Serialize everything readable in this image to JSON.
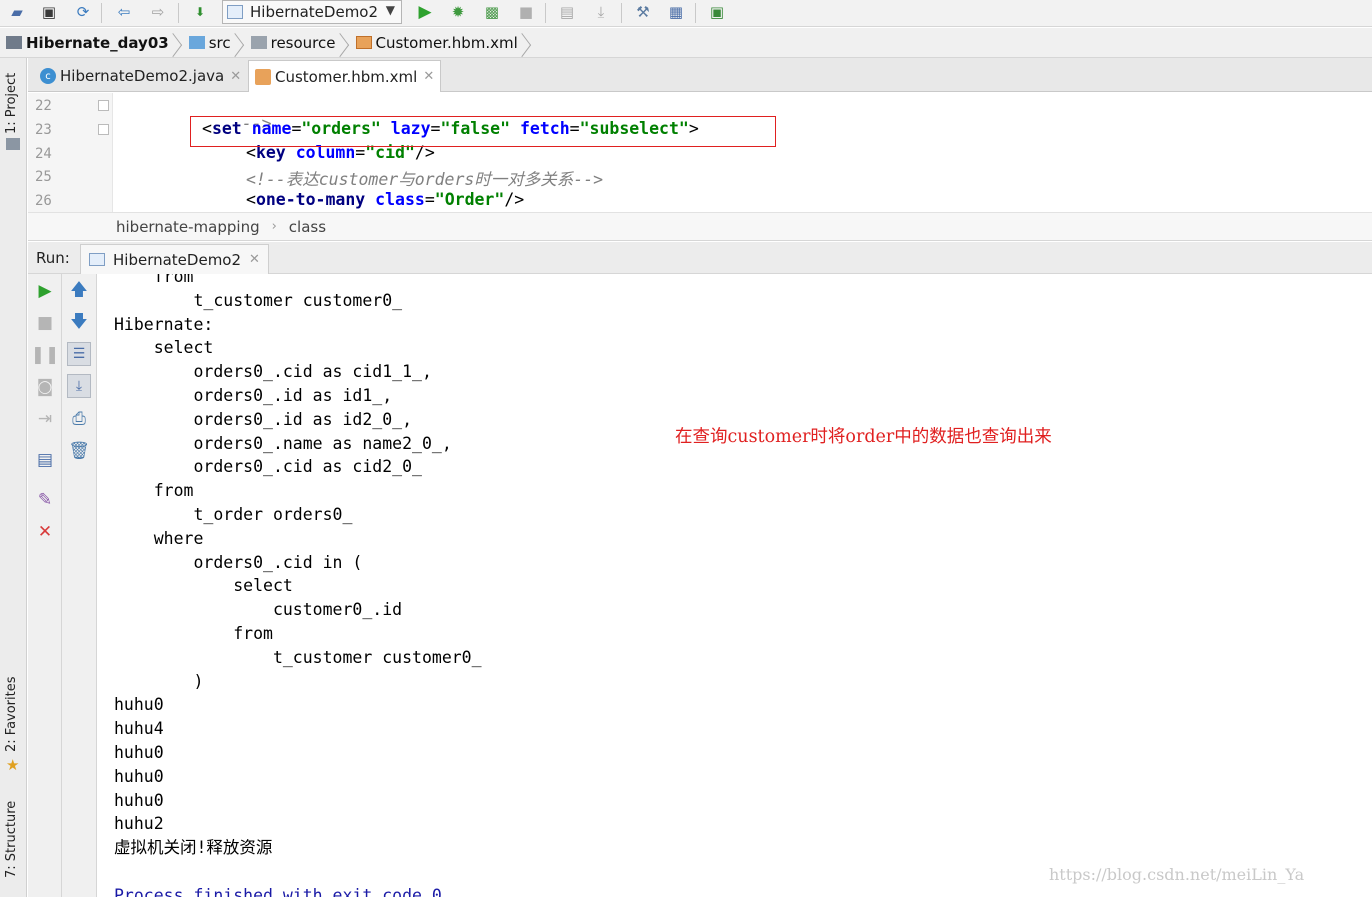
{
  "toolbar": {
    "run_config": "HibernateDemo2"
  },
  "breadcrumb": {
    "items": [
      "Hibernate_day03",
      "src",
      "resource",
      "Customer.hbm.xml"
    ]
  },
  "left_strip": {
    "project": "1: Project",
    "favorites": "2: Favorites",
    "structure": "7: Structure"
  },
  "editor_tabs": [
    {
      "label": "HibernateDemo2.java",
      "icon": "class-icon",
      "active": false
    },
    {
      "label": "Customer.hbm.xml",
      "icon": "xml-file-icon",
      "active": true
    }
  ],
  "editor": {
    "line_numbers": [
      "22",
      "23",
      "24",
      "25",
      "26"
    ],
    "line22": "-->",
    "line23": {
      "open": "<",
      "tag": "set",
      "a1": "name",
      "v1": "\"orders\"",
      "a2": "lazy",
      "v2": "\"false\"",
      "a3": "fetch",
      "v3": "\"subselect\"",
      "close": ">"
    },
    "line24": {
      "open": "<",
      "tag": "key",
      "a1": "column",
      "v1": "\"cid\"",
      "close": "/>"
    },
    "line25": "<!--表达customer与orders时一对多关系-->",
    "line26": {
      "open": "<",
      "tag": "one-to-many",
      "a1": "class",
      "v1": "\"Order\"",
      "close": "/>"
    }
  },
  "xml_path": [
    "hibernate-mapping",
    "class"
  ],
  "run": {
    "label": "Run:",
    "tab": "HibernateDemo2"
  },
  "console": {
    "lines": [
      "    from",
      "        t_customer customer0_",
      "Hibernate:",
      "    select",
      "        orders0_.cid as cid1_1_,",
      "        orders0_.id as id1_,",
      "        orders0_.id as id2_0_,",
      "        orders0_.name as name2_0_,",
      "        orders0_.cid as cid2_0_",
      "    from",
      "        t_order orders0_",
      "    where",
      "        orders0_.cid in (",
      "            select",
      "                customer0_.id",
      "            from",
      "                t_customer customer0_",
      "        )",
      "huhu0",
      "huhu4",
      "huhu0",
      "huhu0",
      "huhu0",
      "huhu2",
      "虚拟机关闭!释放资源",
      "",
      "Process finished with exit code 0"
    ],
    "annotation": "在查询customer时将order中的数据也查询出来",
    "watermark": "https://blog.csdn.net/meiLin_Ya"
  },
  "colors": {
    "annotation": "#e02020",
    "tag": "#000080",
    "attr": "#0000ff",
    "value": "#008000",
    "comment": "#808080"
  }
}
